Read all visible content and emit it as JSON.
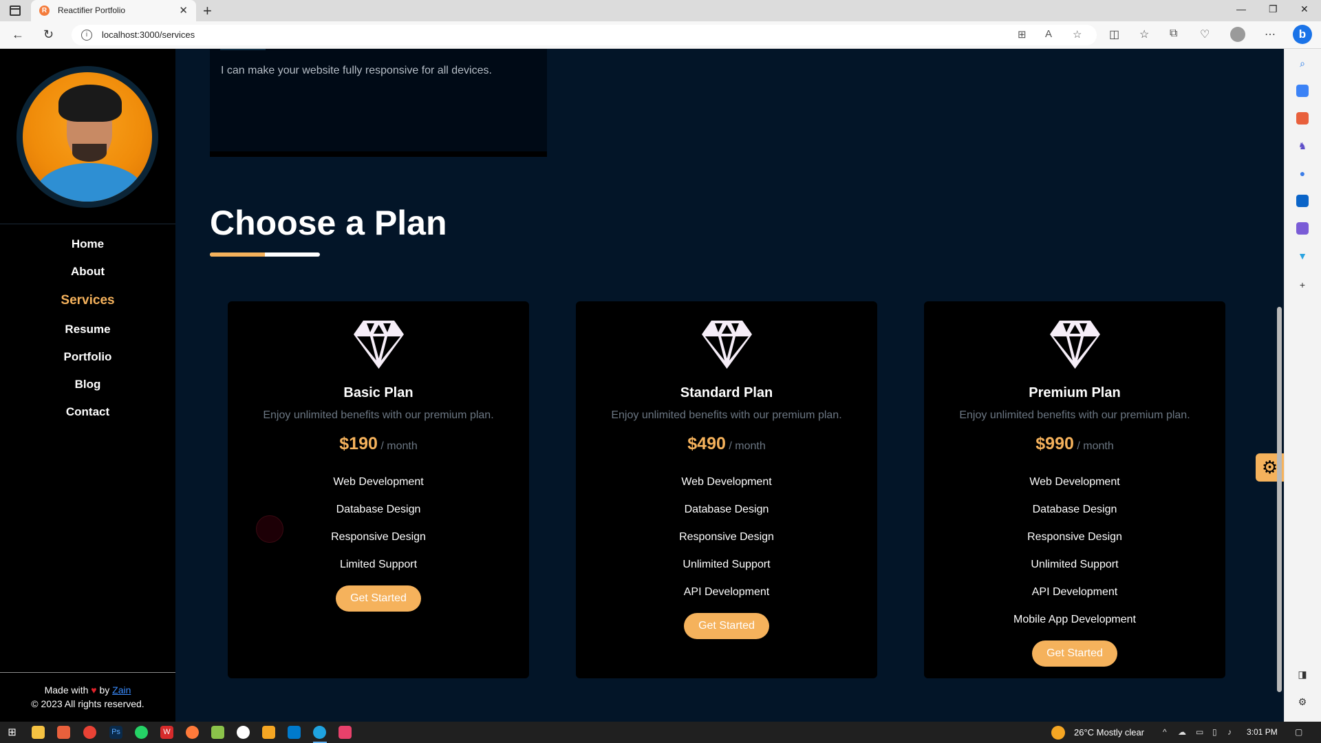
{
  "browser": {
    "tab_title": "Reactifier Portfolio",
    "favicon_letter": "R",
    "url": "localhost:3000/services"
  },
  "sidebar": {
    "nav_items": [
      {
        "label": "Home",
        "active": false
      },
      {
        "label": "About",
        "active": false
      },
      {
        "label": "Services",
        "active": true
      },
      {
        "label": "Resume",
        "active": false
      },
      {
        "label": "Portfolio",
        "active": false
      },
      {
        "label": "Blog",
        "active": false
      },
      {
        "label": "Contact",
        "active": false
      }
    ],
    "footer": {
      "made_with": "Made with",
      "heart": "♥",
      "by": "by",
      "author": "Zain",
      "copyright": "© 2023 All rights reserved."
    }
  },
  "service_card": {
    "text": "I can make your website fully responsive for all devices."
  },
  "pricing": {
    "title": "Choose a Plan",
    "plans": [
      {
        "name": "Basic Plan",
        "description": "Enjoy unlimited benefits with our premium plan.",
        "price": "$190",
        "period": "/ month",
        "features": [
          "Web Development",
          "Database Design",
          "Responsive Design",
          "Limited Support"
        ],
        "button": "Get Started"
      },
      {
        "name": "Standard Plan",
        "description": "Enjoy unlimited benefits with our premium plan.",
        "price": "$490",
        "period": "/ month",
        "features": [
          "Web Development",
          "Database Design",
          "Responsive Design",
          "Unlimited Support",
          "API Development"
        ],
        "button": "Get Started"
      },
      {
        "name": "Premium Plan",
        "description": "Enjoy unlimited benefits with our premium plan.",
        "price": "$990",
        "period": "/ month",
        "features": [
          "Web Development",
          "Database Design",
          "Responsive Design",
          "Unlimited Support",
          "API Development",
          "Mobile App Development"
        ],
        "button": "Get Started"
      }
    ]
  },
  "taskbar": {
    "weather": "26°C  Mostly clear",
    "time": "3:01 PM"
  },
  "colors": {
    "accent": "#f5b25c",
    "page_background": "#031528",
    "card_background": "#000000"
  }
}
